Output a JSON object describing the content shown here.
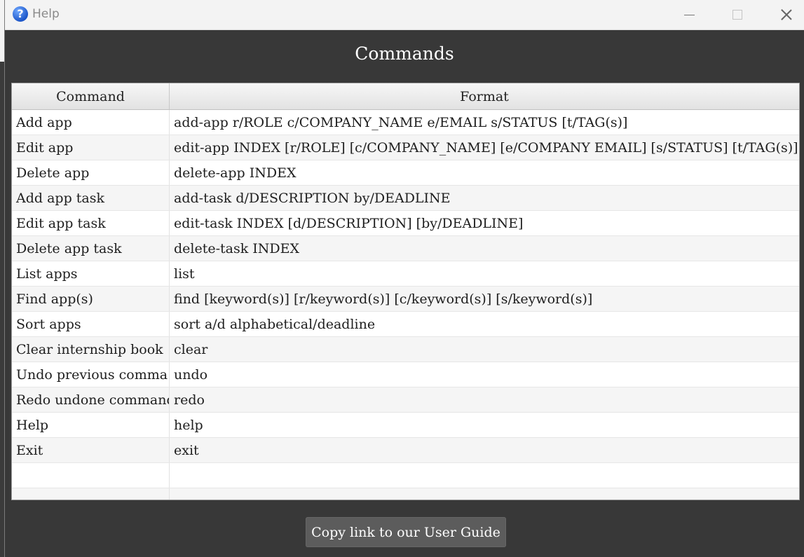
{
  "window": {
    "title": "Help",
    "icon": "question-icon"
  },
  "heading": "Commands",
  "table": {
    "headers": [
      "Command",
      "Format"
    ],
    "rows": [
      {
        "command": "Add app",
        "format": "add-app r/ROLE c/COMPANY_NAME e/EMAIL s/STATUS [t/TAG(s)]"
      },
      {
        "command": "Edit app",
        "format": "edit-app INDEX [r/ROLE] [c/COMPANY_NAME] [e/COMPANY EMAIL] [s/STATUS] [t/TAG(s)]"
      },
      {
        "command": "Delete app",
        "format": "delete-app INDEX"
      },
      {
        "command": "Add app task",
        "format": "add-task d/DESCRIPTION by/DEADLINE"
      },
      {
        "command": "Edit app task",
        "format": "edit-task INDEX [d/DESCRIPTION] [by/DEADLINE]"
      },
      {
        "command": "Delete app task",
        "format": "delete-task INDEX"
      },
      {
        "command": "List apps",
        "format": "list"
      },
      {
        "command": "Find app(s)",
        "format": "find [keyword(s)] [r/keyword(s)] [c/keyword(s)] [s/keyword(s)]"
      },
      {
        "command": "Sort apps",
        "format": "sort a/d alphabetical/deadline"
      },
      {
        "command": "Clear internship book",
        "format": "clear"
      },
      {
        "command": "Undo previous comma...",
        "format": "undo"
      },
      {
        "command": "Redo undone command",
        "format": "redo"
      },
      {
        "command": "Help",
        "format": "help"
      },
      {
        "command": "Exit",
        "format": "exit"
      },
      {
        "command": "",
        "format": ""
      },
      {
        "command": "",
        "format": ""
      }
    ]
  },
  "copy_button_label": "Copy link to our User Guide"
}
